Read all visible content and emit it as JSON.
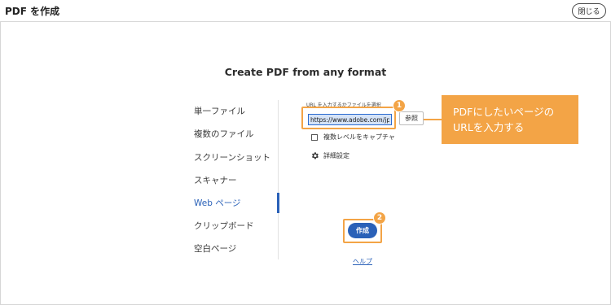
{
  "header": {
    "title": "PDF を作成",
    "close_label": "閉じる"
  },
  "main": {
    "heading": "Create PDF from any format"
  },
  "sidebar": {
    "items": [
      {
        "label": "単一ファイル"
      },
      {
        "label": "複数のファイル"
      },
      {
        "label": "スクリーンショット"
      },
      {
        "label": "スキャナー"
      },
      {
        "label": "Web ページ",
        "active": true
      },
      {
        "label": "クリップボード"
      },
      {
        "label": "空白ページ"
      }
    ]
  },
  "form": {
    "url_label": "URL を入力するかファイルを選択",
    "url_value": "https://www.adobe.com/jp/a",
    "browse_label": "参照",
    "checkbox_label": "複数レベルをキャプチャ",
    "settings_label": "詳細設定",
    "settings_icon": "gear-icon",
    "create_label": "作成",
    "help_label": "ヘルプ"
  },
  "annotations": {
    "badge_1": "1",
    "badge_2": "2",
    "callout_line_1": "PDFにしたいページの",
    "callout_line_2": "URLを入力する",
    "accent_color": "#f3a446"
  },
  "colors": {
    "primary": "#2a61b8",
    "accent": "#f3a446"
  }
}
